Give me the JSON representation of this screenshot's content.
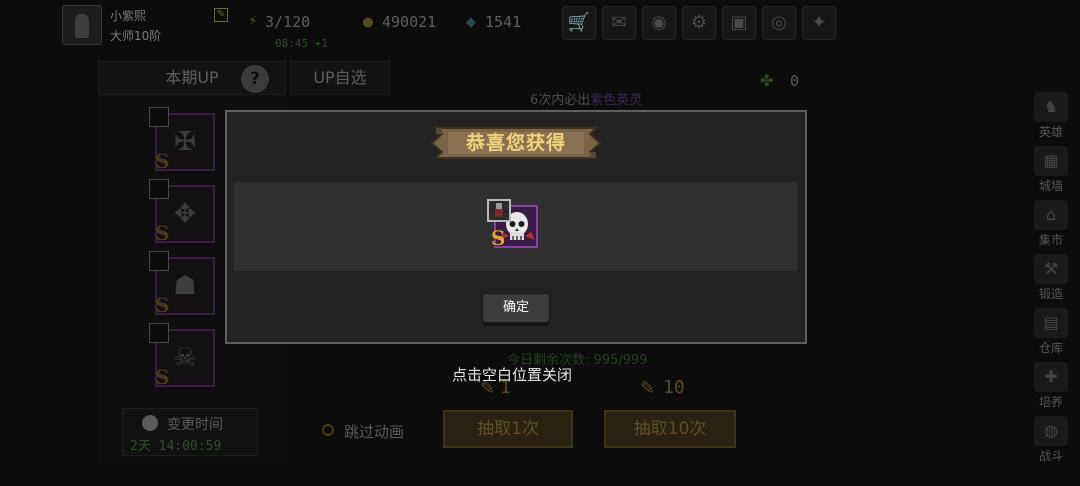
{
  "player": {
    "name": "小紫熙",
    "rank": "大师10阶"
  },
  "resources": {
    "stamina": "3/120",
    "stamina_timer": "08:45 +1",
    "gold": "490021",
    "gems": "1541"
  },
  "top_buttons": [
    "shop-cart-icon",
    "mail-icon",
    "gamepad-icon",
    "settings-gear-icon",
    "gift-icon",
    "wheel-icon",
    "event-icon"
  ],
  "tabs": {
    "current_up": "本期UP",
    "up_choice": "UP自选"
  },
  "guarantee": {
    "prefix": "6次内必出",
    "highlight": "紫色英灵"
  },
  "leaf_count": "0",
  "change_time": {
    "label": "变更时间",
    "value": "2天 14:00:59"
  },
  "side_nav": [
    "英雄",
    "城墙",
    "集市",
    "锻造",
    "仓库",
    "培养",
    "战斗"
  ],
  "today_remaining": "今日剩余次数: 995/999",
  "close_hint": "点击空白位置关闭",
  "costs": {
    "single": "1",
    "ten": "10"
  },
  "skip_label": "跳过动画",
  "draw": {
    "once": "抽取1次",
    "ten": "抽取10次"
  },
  "modal": {
    "title": "恭喜您获得",
    "reward_grade": "S",
    "confirm_label": "确定"
  },
  "colors": {
    "banner_text": "#f3d37a",
    "reward_frame": "#8a3fa2",
    "grade_s": "#e0a23a"
  }
}
